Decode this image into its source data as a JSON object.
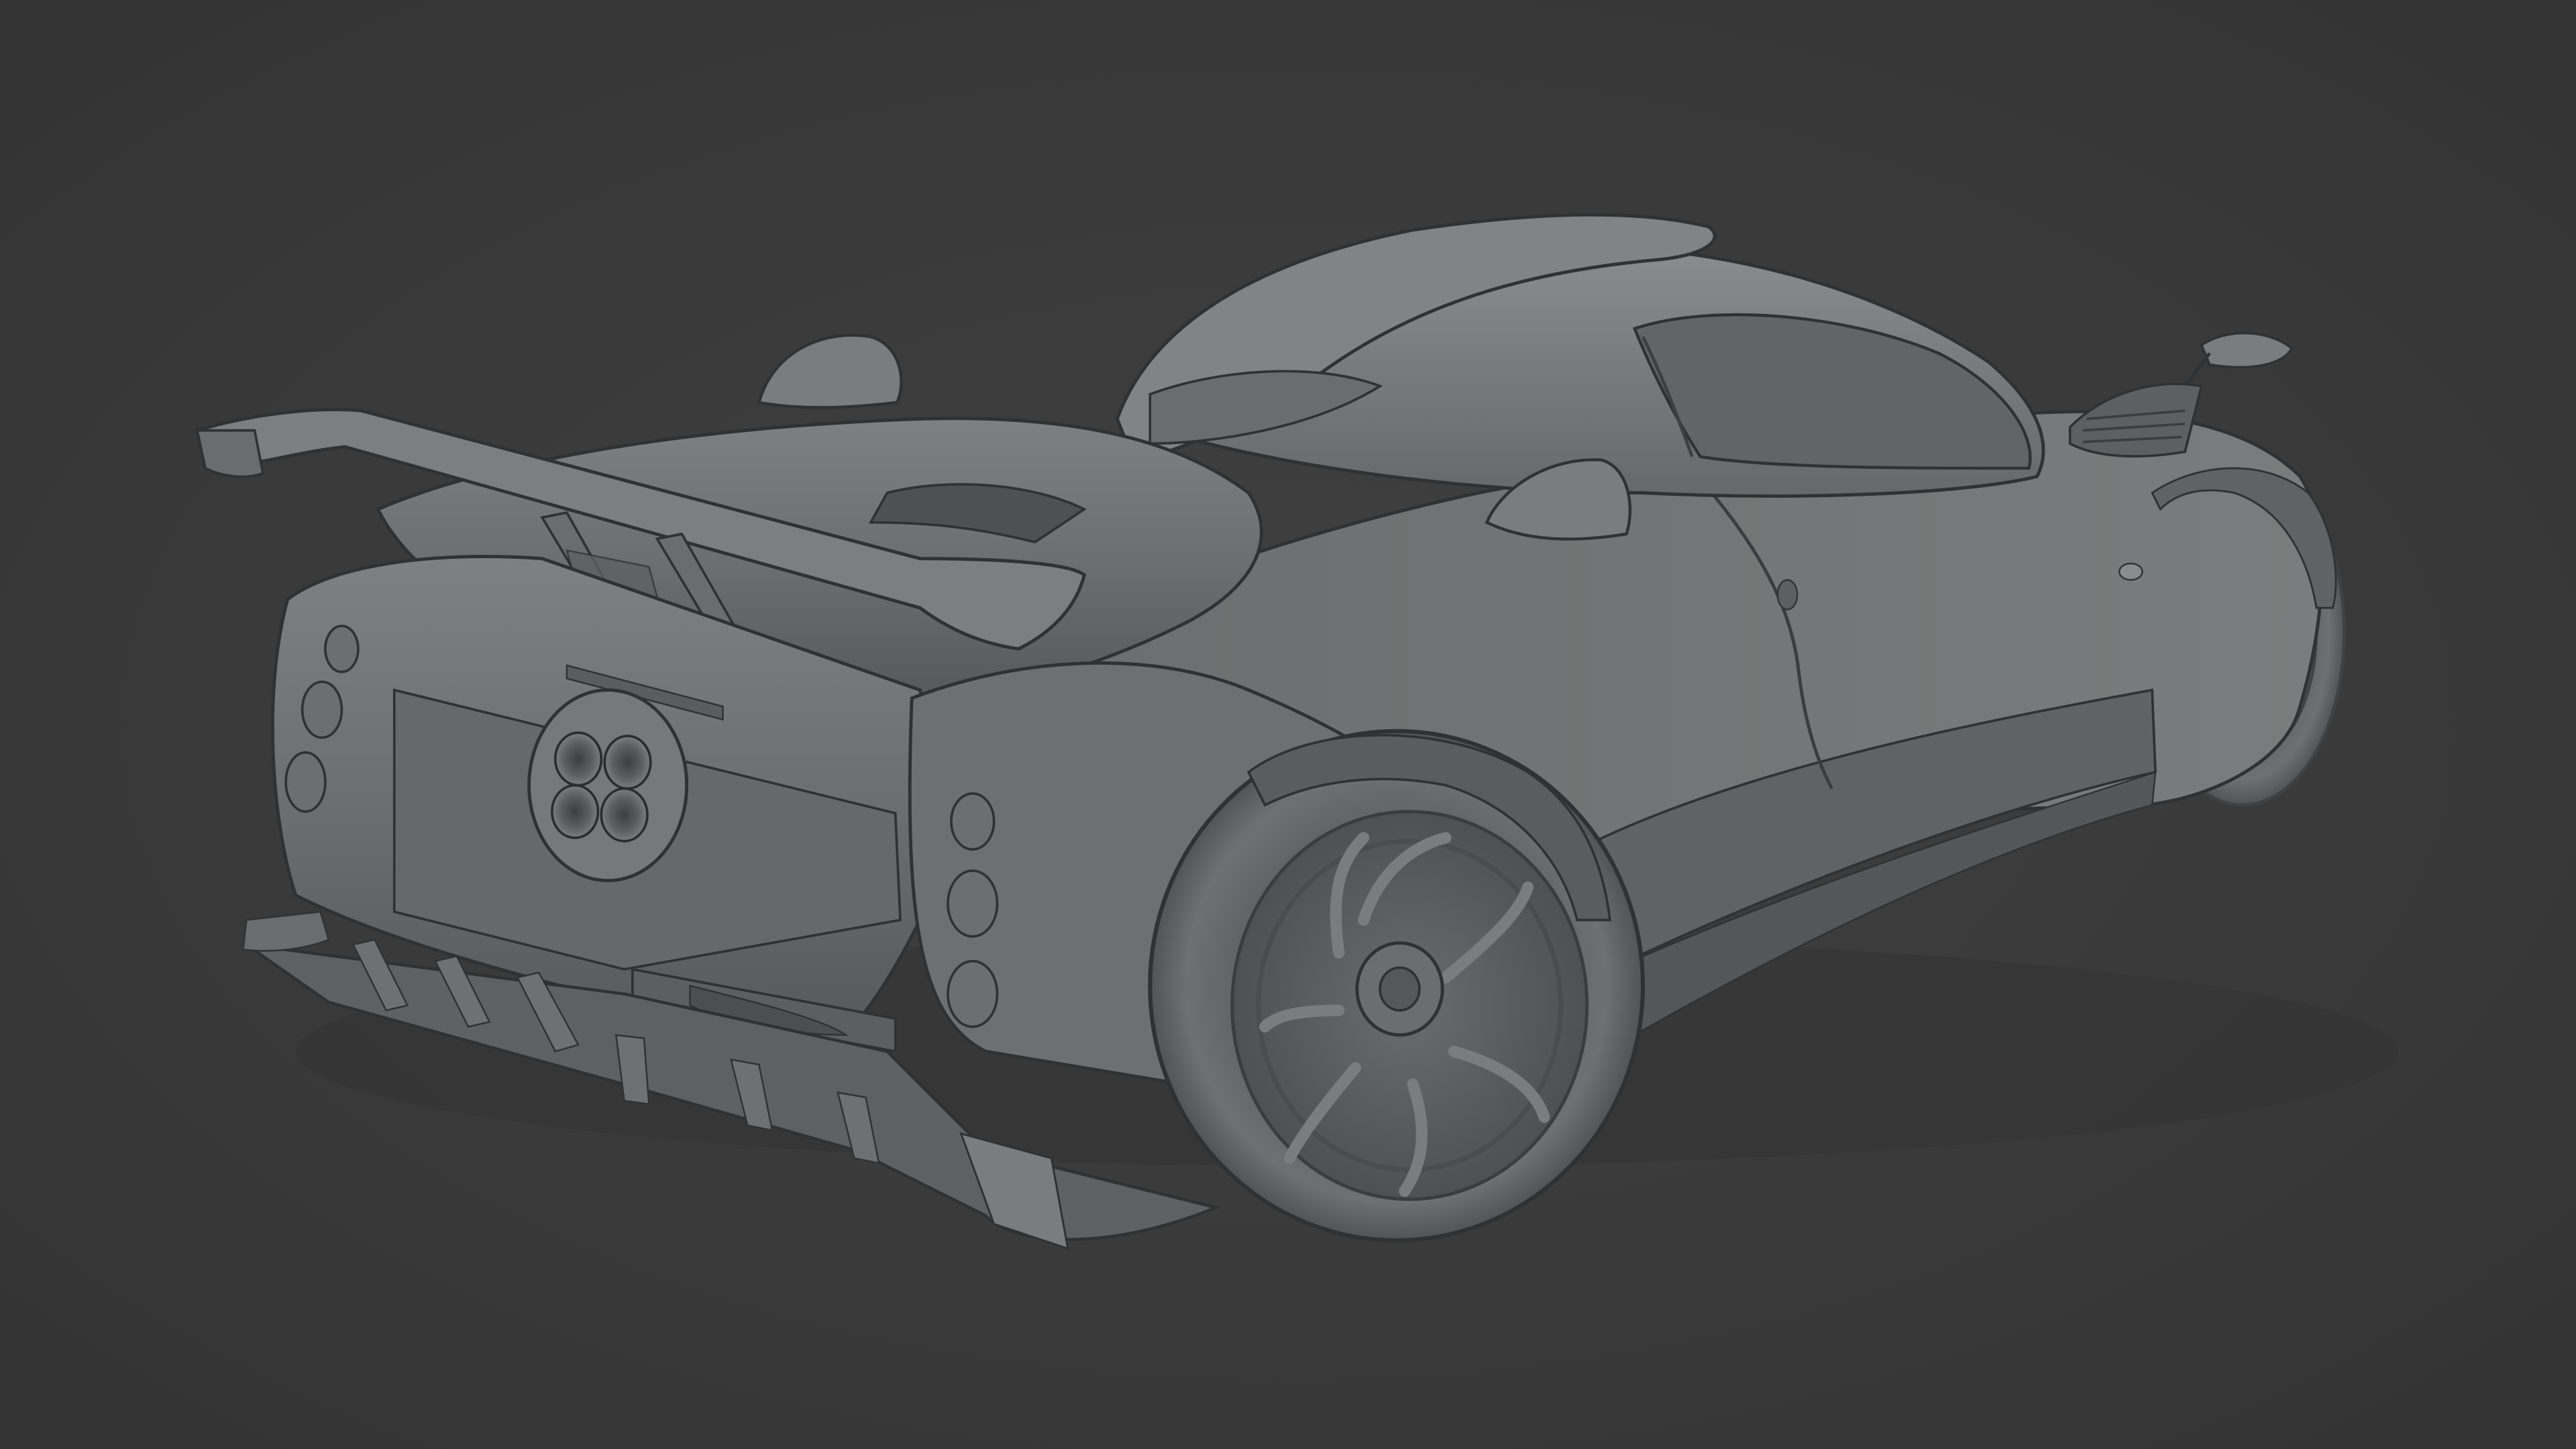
{
  "scene": {
    "subject": "car-clay-render",
    "background_color": "#3a3a3a",
    "body_color": "#6f7172",
    "highlight_color": "#8c8e8f",
    "shadow_color": "#4a4c4d",
    "line_color": "#2e3031"
  }
}
